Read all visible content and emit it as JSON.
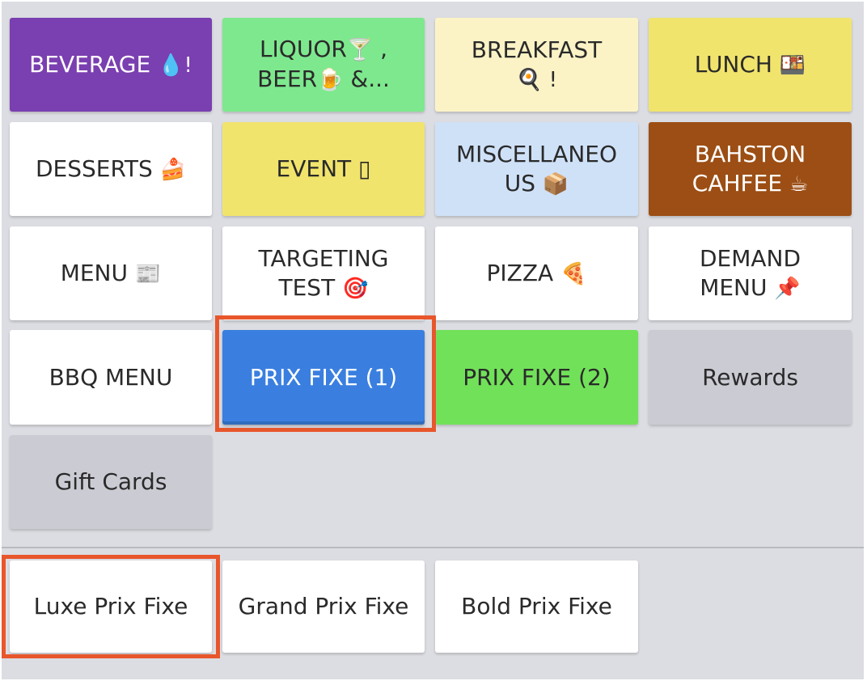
{
  "colors": {
    "panel_bg": "#dcdde2",
    "highlight": "#e8562c",
    "beverage": "#7a3fb0",
    "liquor": "#7ee88e",
    "breakfast": "#fbf3c6",
    "lunch": "#f1e46c",
    "white": "#ffffff",
    "event": "#f1e46c",
    "misc": "#cfe1f7",
    "bahston": "#9c4e14",
    "prix1": "#3a7fe0",
    "prix2": "#72e15a",
    "grey": "#cbcbd4"
  },
  "categories": [
    {
      "label": "BEVERAGE",
      "emoji": "💧!"
    },
    {
      "label": "LIQUOR",
      "emoji_a": "🍸",
      "suffix_a": " ,",
      "label_b": "BEER",
      "emoji_b": "🍺",
      "suffix_b": "  &..."
    },
    {
      "label": "BREAKFAST",
      "emoji": "🍳 !"
    },
    {
      "label": "LUNCH",
      "emoji": "🍱"
    },
    {
      "label": "DESSERTS",
      "emoji": "🍰"
    },
    {
      "label": "EVENT",
      "emoji": "▯"
    },
    {
      "label": "MISCELLANEO",
      "label_b": "US",
      "emoji": "📦"
    },
    {
      "label": "BAHSTON",
      "label_b": "CAHFEE",
      "emoji": "☕"
    },
    {
      "label": "MENU",
      "emoji": "📰"
    },
    {
      "label": "TARGETING",
      "label_b": "TEST",
      "emoji": "🎯"
    },
    {
      "label": "PIZZA",
      "emoji": "🍕"
    },
    {
      "label": "DEMAND",
      "label_b": "MENU",
      "emoji": "📌"
    },
    {
      "label": "BBQ MENU"
    },
    {
      "label": "PRIX FIXE (1)"
    },
    {
      "label": "PRIX FIXE (2)"
    },
    {
      "label": "Rewards"
    },
    {
      "label": "Gift Cards"
    }
  ],
  "sub_menu": [
    {
      "label": "Luxe Prix Fixe"
    },
    {
      "label": "Grand Prix Fixe"
    },
    {
      "label": "Bold Prix Fixe"
    }
  ]
}
